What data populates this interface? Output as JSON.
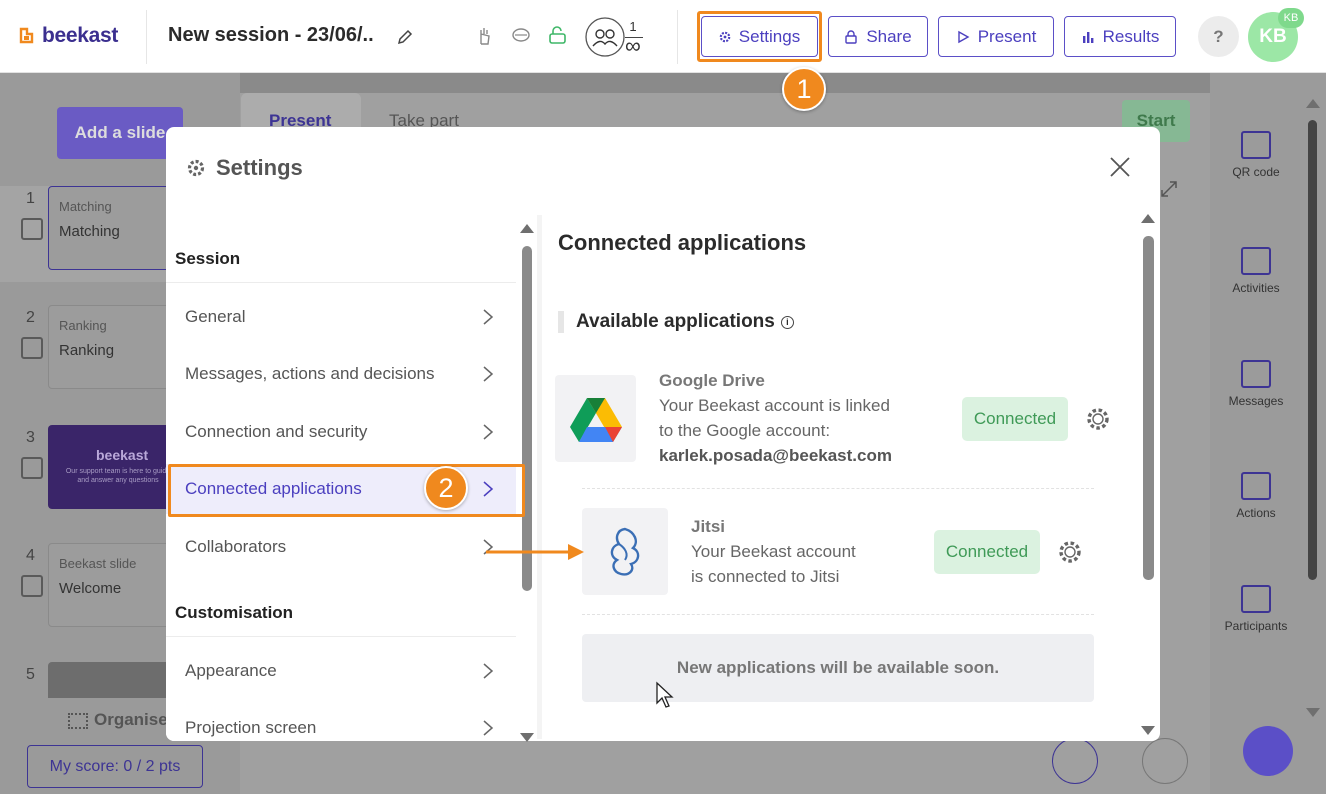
{
  "header": {
    "logo_text": "beekast",
    "session_title": "New session - 23/06/...",
    "participants_current": "1",
    "participants_max": "∞",
    "buttons": {
      "settings": "Settings",
      "share": "Share",
      "present": "Present",
      "results": "Results",
      "help": "?"
    },
    "avatar_initials": "KB",
    "avatar_badge": "KB"
  },
  "annotations": {
    "step1": "1",
    "step2": "2"
  },
  "background": {
    "add_slide": "Add a slide",
    "tabs": {
      "present": "Present",
      "take_part": "Take part"
    },
    "start": "Start",
    "slides": [
      {
        "num": "1",
        "subtitle": "Matching",
        "title": "Matching"
      },
      {
        "num": "2",
        "subtitle": "Ranking",
        "title": "Ranking"
      },
      {
        "num": "3",
        "subtitle": "",
        "title": "beekast",
        "caption": "Our support team is here to guide and answer any questions"
      },
      {
        "num": "4",
        "subtitle": "Beekast slide",
        "title": "Welcome"
      },
      {
        "num": "5",
        "subtitle": "",
        "title": ""
      }
    ],
    "organise": "Organise",
    "score": "My score: 0 / 2 pts",
    "right_panel": [
      "QR code",
      "Activities",
      "Messages",
      "Actions",
      "Participants"
    ]
  },
  "modal": {
    "title": "Settings",
    "nav": {
      "session_heading": "Session",
      "session_items": [
        "General",
        "Messages, actions and decisions",
        "Connection and security",
        "Connected applications",
        "Collaborators"
      ],
      "customisation_heading": "Customisation",
      "customisation_items": [
        "Appearance",
        "Projection screen"
      ]
    },
    "panel_title": "Connected applications",
    "available_title": "Available applications",
    "apps": [
      {
        "name": "Google Drive",
        "desc_line1": "Your Beekast account is linked",
        "desc_line2": "to the Google account:",
        "email": "karlek.posada@beekast.com",
        "status": "Connected"
      },
      {
        "name": "Jitsi",
        "desc_line1": "Your Beekast account",
        "desc_line2": "is connected to Jitsi",
        "status": "Connected"
      }
    ],
    "soon_text": "New applications will be available soon."
  },
  "colors": {
    "brand": "#3b2f8f",
    "accent": "#5b4fc7",
    "annotation": "#f0891e",
    "connected_bg": "#dbf2e0",
    "connected_text": "#3f9a57"
  }
}
